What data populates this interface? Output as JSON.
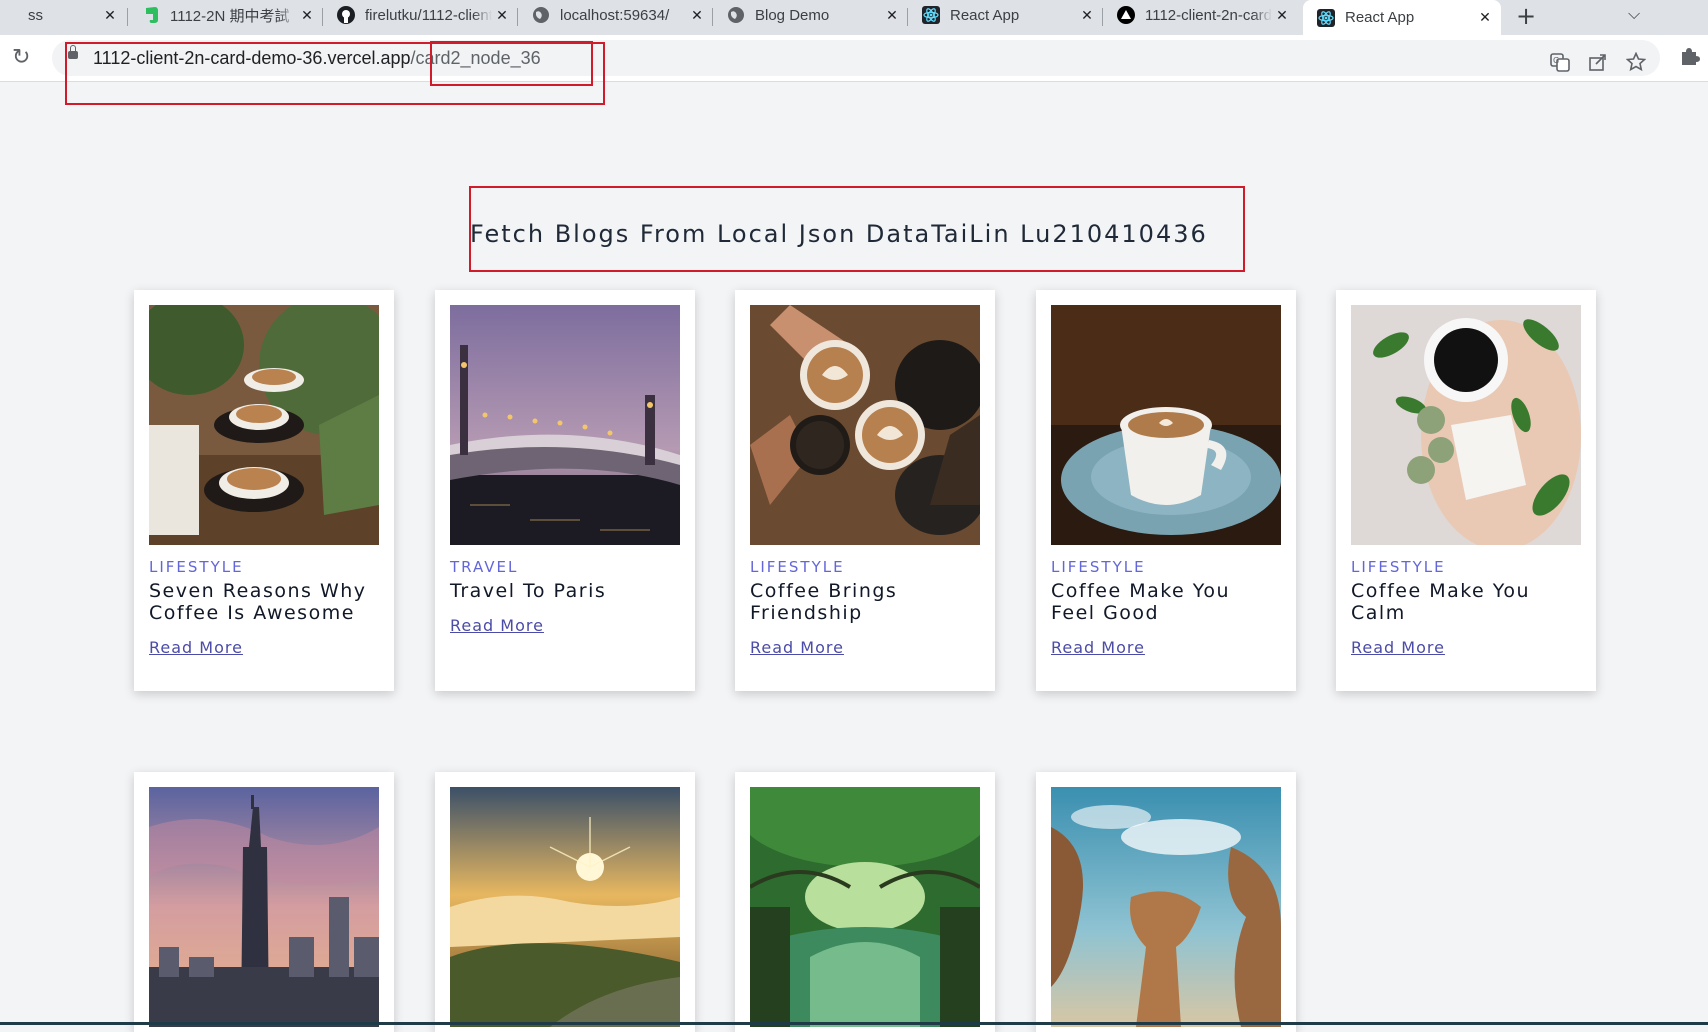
{
  "browser": {
    "tabs": [
      {
        "title": "ss",
        "icon": "page-icon"
      },
      {
        "title": "1112-2N 期中考試",
        "icon": "evernote-icon"
      },
      {
        "title": "firelutku/1112-client",
        "icon": "github-icon"
      },
      {
        "title": "localhost:59634/",
        "icon": "globe-icon"
      },
      {
        "title": "Blog Demo",
        "icon": "globe-icon"
      },
      {
        "title": "React App",
        "icon": "react-icon"
      },
      {
        "title": "1112-client-2n-card",
        "icon": "vercel-icon"
      },
      {
        "title": "React App",
        "icon": "react-icon",
        "active": true
      }
    ],
    "url_host": "1112-client-2n-card-demo-36.vercel.app",
    "url_path": "/card2_node_36"
  },
  "page": {
    "heading": "Fetch Blogs From Local Json DataTaiLin Lu210410436",
    "read_more": "Read More",
    "cards": [
      {
        "category": "LIFESTYLE",
        "title": "Seven Reasons Why Coffee Is Awesome",
        "image": "coffee-cups-plants"
      },
      {
        "category": "TRAVEL",
        "title": "Travel To Paris",
        "image": "paris-bridge"
      },
      {
        "category": "LIFESTYLE",
        "title": "Coffee Brings Friendship",
        "image": "coffee-cheers"
      },
      {
        "category": "LIFESTYLE",
        "title": "Coffee Make You Feel Good",
        "image": "coffee-blue-saucer"
      },
      {
        "category": "LIFESTYLE",
        "title": "Coffee Make You Calm",
        "image": "coffee-flatlay"
      },
      {
        "category": "",
        "title": "",
        "image": "taipei-101"
      },
      {
        "category": "",
        "title": "",
        "image": "sunrise-sea-of-clouds"
      },
      {
        "category": "",
        "title": "",
        "image": "mangrove-tunnel"
      },
      {
        "category": "",
        "title": "",
        "image": "yehliu-rocks"
      }
    ]
  },
  "colors": {
    "accent": "#6366d9",
    "link": "#4b4ba8",
    "annotation": "#d11a2a"
  }
}
